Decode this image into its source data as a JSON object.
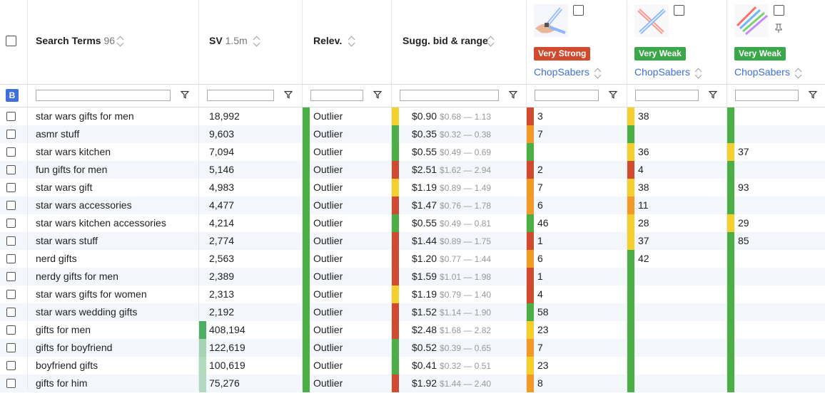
{
  "header": {
    "search_terms_label": "Search Terms",
    "search_terms_count": "96",
    "sv_label": "SV",
    "sv_total": "1.5m",
    "relev_label": "Relev.",
    "bid_label": "Sugg. bid & range",
    "filter_badge": "B"
  },
  "competitors": [
    {
      "strength": "Very Strong",
      "strength_color": "#d04a30",
      "brand": "ChopSabers",
      "icon": "lightsaber-hand-icon"
    },
    {
      "strength": "Very Weak",
      "strength_color": "#3aa84a",
      "brand": "ChopSabers",
      "icon": "crossed-lightsabers-icon"
    },
    {
      "strength": "Very Weak",
      "strength_color": "#3aa84a",
      "brand": "ChopSabers",
      "icon": "lightsaber-set-icon",
      "pinned": true
    }
  ],
  "colors": {
    "green": "#4caf45",
    "red": "#cf4a2e",
    "yellow": "#f5cf2c",
    "orange": "#f29a27",
    "alt_row": "#f3f6fa",
    "brand_blue": "#3f6fd8"
  },
  "rows": [
    {
      "term": "star wars gifts for men",
      "sv": "18,992",
      "sv_fill": 0,
      "relev": "Outlier",
      "bid": "$0.90",
      "range": "$0.68 — 1.13",
      "bid_c": "yellow",
      "c1": "3",
      "c1c": "red",
      "c2": "38",
      "c2c": "yellow",
      "c3": "",
      "c3c": "green"
    },
    {
      "term": "asmr stuff",
      "sv": "9,603",
      "sv_fill": 0,
      "relev": "Outlier",
      "bid": "$0.35",
      "range": "$0.32 — 0.38",
      "bid_c": "green",
      "c1": "7",
      "c1c": "orange",
      "c2": "",
      "c2c": "green",
      "c3": "",
      "c3c": "green"
    },
    {
      "term": "star wars kitchen",
      "sv": "7,094",
      "sv_fill": 0,
      "relev": "Outlier",
      "bid": "$0.55",
      "range": "$0.49 — 0.69",
      "bid_c": "green",
      "c1": "",
      "c1c": "green",
      "c2": "36",
      "c2c": "yellow",
      "c3": "37",
      "c3c": "yellow"
    },
    {
      "term": "fun gifts for men",
      "sv": "5,146",
      "sv_fill": 0,
      "relev": "Outlier",
      "bid": "$2.51",
      "range": "$1.62 — 2.94",
      "bid_c": "red",
      "c1": "2",
      "c1c": "red",
      "c2": "4",
      "c2c": "red",
      "c3": "",
      "c3c": "green"
    },
    {
      "term": "star wars gift",
      "sv": "4,983",
      "sv_fill": 0,
      "relev": "Outlier",
      "bid": "$1.19",
      "range": "$0.89 — 1.49",
      "bid_c": "yellow",
      "c1": "7",
      "c1c": "orange",
      "c2": "38",
      "c2c": "yellow",
      "c3": "93",
      "c3c": "green"
    },
    {
      "term": "star wars accessories",
      "sv": "4,477",
      "sv_fill": 0,
      "relev": "Outlier",
      "bid": "$1.47",
      "range": "$0.76 — 1.78",
      "bid_c": "red",
      "c1": "6",
      "c1c": "orange",
      "c2": "11",
      "c2c": "orange",
      "c3": "",
      "c3c": "green"
    },
    {
      "term": "star wars kitchen accessories",
      "sv": "4,214",
      "sv_fill": 0,
      "relev": "Outlier",
      "bid": "$0.55",
      "range": "$0.49 — 0.81",
      "bid_c": "green",
      "c1": "46",
      "c1c": "green",
      "c2": "28",
      "c2c": "yellow",
      "c3": "29",
      "c3c": "yellow"
    },
    {
      "term": "star wars stuff",
      "sv": "2,774",
      "sv_fill": 0,
      "relev": "Outlier",
      "bid": "$1.44",
      "range": "$0.89 — 1.75",
      "bid_c": "red",
      "c1": "1",
      "c1c": "red",
      "c2": "37",
      "c2c": "yellow",
      "c3": "85",
      "c3c": "green"
    },
    {
      "term": "nerd gifts",
      "sv": "2,563",
      "sv_fill": 0,
      "relev": "Outlier",
      "bid": "$1.20",
      "range": "$0.77 — 1.44",
      "bid_c": "red",
      "c1": "6",
      "c1c": "orange",
      "c2": "42",
      "c2c": "green",
      "c3": "",
      "c3c": "green"
    },
    {
      "term": "nerdy gifts for men",
      "sv": "2,389",
      "sv_fill": 0,
      "relev": "Outlier",
      "bid": "$1.59",
      "range": "$1.01 — 1.98",
      "bid_c": "red",
      "c1": "1",
      "c1c": "red",
      "c2": "",
      "c2c": "green",
      "c3": "",
      "c3c": "green"
    },
    {
      "term": "star wars gifts for women",
      "sv": "2,313",
      "sv_fill": 0,
      "relev": "Outlier",
      "bid": "$1.19",
      "range": "$0.79 — 1.40",
      "bid_c": "yellow",
      "c1": "4",
      "c1c": "red",
      "c2": "",
      "c2c": "green",
      "c3": "",
      "c3c": "green"
    },
    {
      "term": "star wars wedding gifts",
      "sv": "2,192",
      "sv_fill": 0,
      "relev": "Outlier",
      "bid": "$1.52",
      "range": "$1.14 — 1.90",
      "bid_c": "red",
      "c1": "58",
      "c1c": "green",
      "c2": "",
      "c2c": "green",
      "c3": "",
      "c3c": "green"
    },
    {
      "term": "gifts for men",
      "sv": "408,194",
      "sv_fill": 1.0,
      "relev": "Outlier",
      "bid": "$2.48",
      "range": "$1.68 — 2.82",
      "bid_c": "red",
      "c1": "23",
      "c1c": "yellow",
      "c2": "",
      "c2c": "green",
      "c3": "",
      "c3c": "green"
    },
    {
      "term": "gifts for boyfriend",
      "sv": "122,619",
      "sv_fill": 0.3,
      "relev": "Outlier",
      "bid": "$0.52",
      "range": "$0.39 — 0.65",
      "bid_c": "green",
      "c1": "7",
      "c1c": "orange",
      "c2": "",
      "c2c": "green",
      "c3": "",
      "c3c": "green"
    },
    {
      "term": "boyfriend gifts",
      "sv": "100,619",
      "sv_fill": 0.25,
      "relev": "Outlier",
      "bid": "$0.41",
      "range": "$0.32 — 0.51",
      "bid_c": "green",
      "c1": "23",
      "c1c": "yellow",
      "c2": "",
      "c2c": "green",
      "c3": "",
      "c3c": "green"
    },
    {
      "term": "gifts for him",
      "sv": "75,276",
      "sv_fill": 0.18,
      "relev": "Outlier",
      "bid": "$1.92",
      "range": "$1.44 — 2.40",
      "bid_c": "red",
      "c1": "8",
      "c1c": "orange",
      "c2": "",
      "c2c": "green",
      "c3": "",
      "c3c": "green"
    }
  ]
}
